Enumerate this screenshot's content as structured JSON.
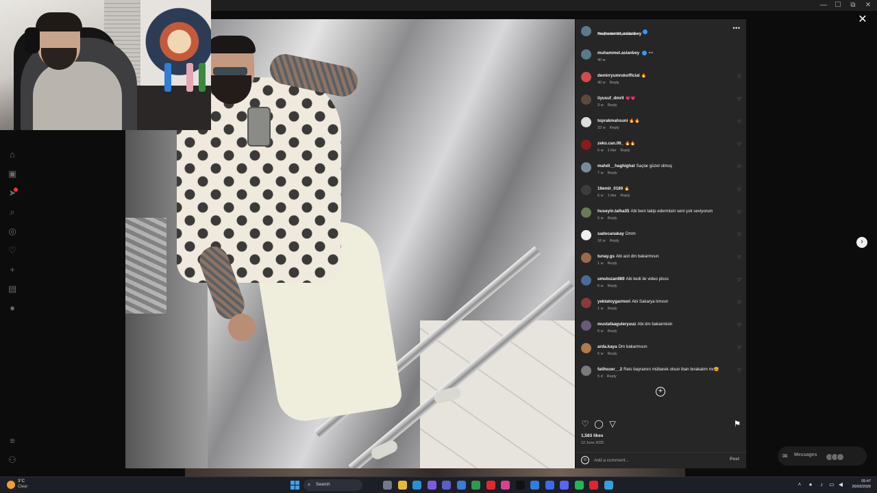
{
  "window": {
    "minimize": "—",
    "maximize": "☐",
    "restore": "⧉",
    "close": "✕"
  },
  "nav": {
    "icons": [
      "home-icon",
      "reels-icon",
      "explore-icon",
      "search-icon",
      "compass-icon",
      "heart-icon",
      "create-icon",
      "dashboard-icon",
      "profile-icon",
      "menu-icon",
      "threads-icon"
    ]
  },
  "post": {
    "author": "muhammet.aslanbey",
    "location": "Bosphorus City Halkalı",
    "caption_author": "muhammet.aslanbey",
    "caption_text": "👓",
    "caption_time": "40 w",
    "likes": "1,583 likes",
    "date": "12 June 2025",
    "comment_placeholder": "Add a comment...",
    "post_label": "Post"
  },
  "comments": [
    {
      "user": "demirryumrukofficial",
      "text": "🔥",
      "time": "40 w",
      "likes": "",
      "reply": "Reply",
      "color": "#d34b4b"
    },
    {
      "user": "iiyusuf_dmrll",
      "text": "💗💗",
      "time": "3 w",
      "likes": "",
      "reply": "Reply",
      "color": "#5a4a3a"
    },
    {
      "user": "toprakmahsuni",
      "text": "🔥🔥",
      "time": "33 w",
      "likes": "",
      "reply": "Reply",
      "color": "#dddddd"
    },
    {
      "user": "zeko.can.06_",
      "text": "🔥🔥",
      "time": "6 w",
      "likes": "1 like",
      "reply": "Reply",
      "color": "#8b1a1a"
    },
    {
      "user": "mahdi__haghighat",
      "text": "Saçlar güzel olmuş",
      "time": "7 w",
      "likes": "",
      "reply": "Reply",
      "color": "#7a8a9a"
    },
    {
      "user": "16emir_0189",
      "text": "🔥",
      "time": "6 w",
      "likes": "1 like",
      "reply": "Reply",
      "color": "#3c3c3c"
    },
    {
      "user": "huseyin.talha35",
      "text": "Abi beni takip edermisin seni çok seviyorum",
      "time": "6 w",
      "likes": "",
      "reply": "Reply",
      "color": "#6a7a5a"
    },
    {
      "user": "sadocanakay",
      "text": "Dmm",
      "time": "16 w",
      "likes": "",
      "reply": "Reply",
      "color": "#f0f0f0"
    },
    {
      "user": "tunay.gs",
      "text": "Abi acil dm bakarmısın",
      "time": "1 w",
      "likes": "",
      "reply": "Reply",
      "color": "#9a6a4a"
    },
    {
      "user": "umutozan989",
      "text": "Abi kedi ile video plsss",
      "time": "6 w",
      "likes": "",
      "reply": "Reply",
      "color": "#4a6a9a"
    },
    {
      "user": "yektatoygarmori",
      "text": "Abi Sakarya lımısın",
      "time": "1 w",
      "likes": "",
      "reply": "Reply",
      "color": "#8a3a3a"
    },
    {
      "user": "mustafaaguleryuuz",
      "text": "Abi dm bakarmisin",
      "time": "5 w",
      "likes": "",
      "reply": "Reply",
      "color": "#6a5a7a"
    },
    {
      "user": "arda.kaya",
      "text": "Dm bakarmısın",
      "time": "6 w",
      "likes": "",
      "reply": "Reply",
      "color": "#b07a4a"
    },
    {
      "user": "fatihozer__2",
      "text": "Reis bayramın mübarek olsun iban bırakalım mı🥰",
      "time": "5 d",
      "likes": "",
      "reply": "Reply",
      "color": "#7a7a7a"
    }
  ],
  "overlay": {
    "close": "✕",
    "next": "›",
    "messages_label": "Messages"
  },
  "taskbar": {
    "weather_temp": "3°C",
    "weather_desc": "Clear",
    "search_label": "Search",
    "time": "05:47",
    "date": "26/03/2026",
    "apps": [
      {
        "name": "task-view-icon",
        "color": "#6f7b89"
      },
      {
        "name": "file-explorer-icon",
        "color": "#e9b73a"
      },
      {
        "name": "edge-icon",
        "color": "#2b8fd6"
      },
      {
        "name": "copilot-icon",
        "color": "#7b5ce0"
      },
      {
        "name": "teams-icon",
        "color": "#5b5fc7"
      },
      {
        "name": "store-icon",
        "color": "#3a7bd5"
      },
      {
        "name": "chrome-icon",
        "color": "#2e9b4c"
      },
      {
        "name": "youtube-icon",
        "color": "#e02a2a"
      },
      {
        "name": "instagram-icon",
        "color": "#d9428a"
      },
      {
        "name": "tiktok-icon",
        "color": "#111111"
      },
      {
        "name": "todo-icon",
        "color": "#2b7fe0"
      },
      {
        "name": "messenger-icon",
        "color": "#3d6ae8"
      },
      {
        "name": "discord-icon",
        "color": "#5865f2"
      },
      {
        "name": "spotify-icon",
        "color": "#1db954"
      },
      {
        "name": "opera-icon",
        "color": "#e0252f"
      },
      {
        "name": "notepad-icon",
        "color": "#30a0e0"
      }
    ]
  }
}
